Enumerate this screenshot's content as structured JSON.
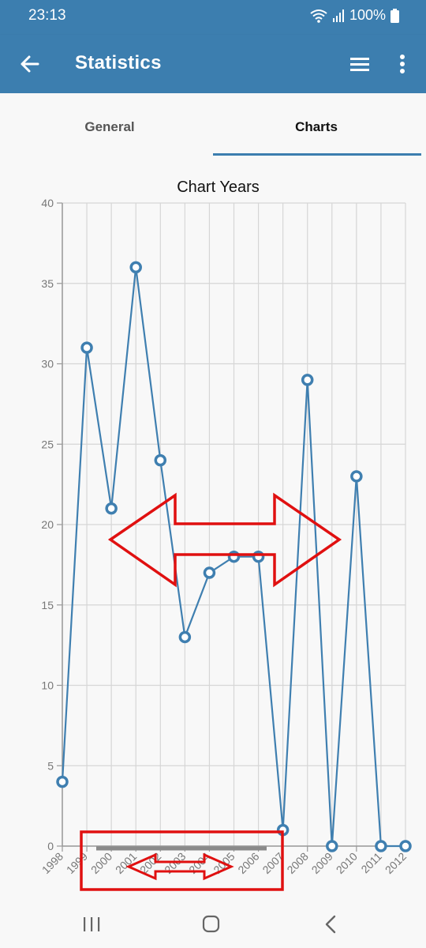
{
  "status": {
    "time": "23:13",
    "battery": "100%"
  },
  "appbar": {
    "title": "Statistics",
    "back_icon": "arrow-left-icon",
    "menu_icon": "hamburger-menu-icon",
    "more_icon": "more-vert-icon"
  },
  "tabs": [
    {
      "label": "General",
      "active": false
    },
    {
      "label": "Charts",
      "active": true
    }
  ],
  "chart_data": {
    "type": "line",
    "title": "Chart Years",
    "x": [
      "1998",
      "1999",
      "2000",
      "2001",
      "2002",
      "2003",
      "2004",
      "2005",
      "2006",
      "2007",
      "2008",
      "2009",
      "2010",
      "2011",
      "2012"
    ],
    "values": [
      4,
      31,
      21,
      36,
      24,
      13,
      17,
      18,
      18,
      1,
      29,
      0,
      23,
      0,
      0
    ],
    "ylim": [
      0,
      40
    ],
    "yticks": [
      0,
      5,
      10,
      15,
      20,
      25,
      30,
      35,
      40
    ],
    "grid": true,
    "line_color": "#3f7fb0",
    "annotation_color": "#e01010"
  },
  "navbar": {
    "recents_icon": "recents-icon",
    "home_icon": "home-icon",
    "back_icon": "nav-back-icon"
  }
}
